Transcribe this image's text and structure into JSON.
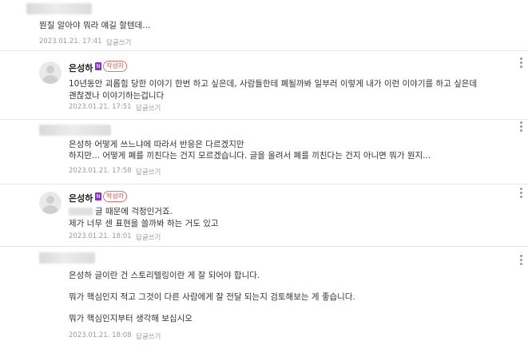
{
  "comments": [
    {
      "author": "",
      "text_lines": [
        "뭔질 알아야 뭐라 얘길 할텐데..."
      ],
      "date": "2023.01.21. 17:41",
      "reply_label": "답글쓰기"
    },
    {
      "author": "은성하",
      "author_badge": "N",
      "writer_badge": "작성자",
      "text_lines": [
        "10년동안 괴롭힘 당한 이야기 한번 하고 싶은데, 사람들한테 폐될까봐 일부러 이렇게 내가 이런 이야기를 하고 싶은데",
        "괜찮겠나 이야기하는겁니다"
      ],
      "date": "2023.01.21. 17:51",
      "reply_label": "답글쓰기"
    },
    {
      "author": "",
      "text_lines": [
        "은성하 어떻게 쓰느냐에 따라서 반응은 다르겠지만",
        "하지만... 어떻게 폐를 끼친다는 건지 모르겠습니다. 글을 올려서 폐를 끼친다는 건지 아니면 뭐가 뭔지..."
      ],
      "date": "2023.01.21. 17:58",
      "reply_label": "답글쓰기"
    },
    {
      "author": "은성하",
      "author_badge": "N",
      "writer_badge": "작성자",
      "text_lines": [
        "글 때문에 걱정인거죠.",
        "제가 너무 센 표현을 쓸까봐 하는 거도 있고"
      ],
      "date": "2023.01.21. 18:01",
      "reply_label": "답글쓰기"
    },
    {
      "author": "",
      "text_lines": [
        "은성하 글이란 건 스토리텔링이란 게 잘 되어야 합니다.",
        "뭐가 핵심인지 적고 그것이 다른 사람에게 잘 전달 되는지 검토해보는 게 좋습니다.",
        "뭐가 핵심인지부터 생각해 보십시오"
      ],
      "date": "2023.01.21. 18:08",
      "reply_label": "답글쓰기"
    }
  ],
  "icons": {
    "more": "more-vertical-icon",
    "avatar": "default-profile-icon"
  },
  "colors": {
    "writer_badge": "#f05050",
    "author_badge": "#8a2be2",
    "meta": "#9a9a9a",
    "divider": "#e6e6e6"
  }
}
